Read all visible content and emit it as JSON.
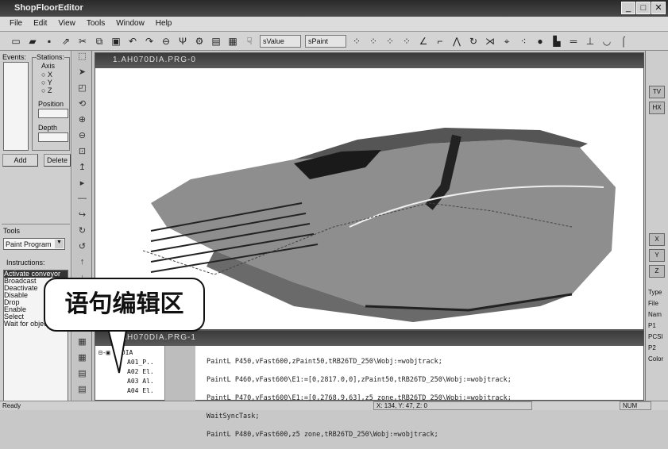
{
  "window": {
    "title": "ShopFloorEditor",
    "minimize": "_",
    "maximize": "□",
    "close": "✕"
  },
  "menu": [
    "File",
    "Edit",
    "View",
    "Tools",
    "Window",
    "Help"
  ],
  "toolbar": {
    "value_select": "sValue",
    "value_select2": "sPaint"
  },
  "left": {
    "events_label": "Events:",
    "stations_label": "Stations:",
    "axis_label": "Axis",
    "axes": [
      "X",
      "Y",
      "Z"
    ],
    "position_label": "Position",
    "depth_label": "Depth",
    "add": "Add",
    "delete": "Delete",
    "tools_label": "Tools",
    "tools_value": "Paint Program",
    "instructions_label": "Instructions:",
    "instructions": [
      "Activate conveyor",
      "Broadcast",
      "Deactivate",
      "Disable",
      "Drop",
      "Enable",
      "Select",
      "Wait for object"
    ]
  },
  "view": {
    "title": "1.AH070DIA.PRG-0"
  },
  "editor": {
    "title": "1.AH070DIA.PRG-1",
    "tree": [
      "⊟-▣ 70DIA",
      "A01_P..",
      "A02 El.",
      "A03 Al.",
      "A04 El."
    ],
    "code": [
      "PaintL P450,vFast600,zPaint50,tRB26TD_250\\Wobj:=wobjtrack;",
      "PaintL P460,vFast600\\E1:=[0,2817.0,0],zPaint50,tRB26TD_250\\Wobj:=wobjtrack;",
      "PaintL P470,vFast600\\E1:=[0,2768.9,63],z5 zone,tRB26TD_250\\Wobj:=wobjtrack;",
      "WaitSyncTask;",
      "PaintL P480,vFast600,z5 zone,tRB26TD_250\\Wobj:=wobjtrack;"
    ]
  },
  "right": {
    "buttons": [
      "TV",
      "HX",
      "X",
      "Y",
      "Z"
    ],
    "labels": [
      "Type",
      "File",
      "Nam",
      "P1",
      "PCSI",
      "P2",
      "Color"
    ]
  },
  "callout": "语句编辑区",
  "status": {
    "left": "Ready",
    "coords": "X: 134, Y: 47, Z: 0",
    "num": "NUM"
  }
}
